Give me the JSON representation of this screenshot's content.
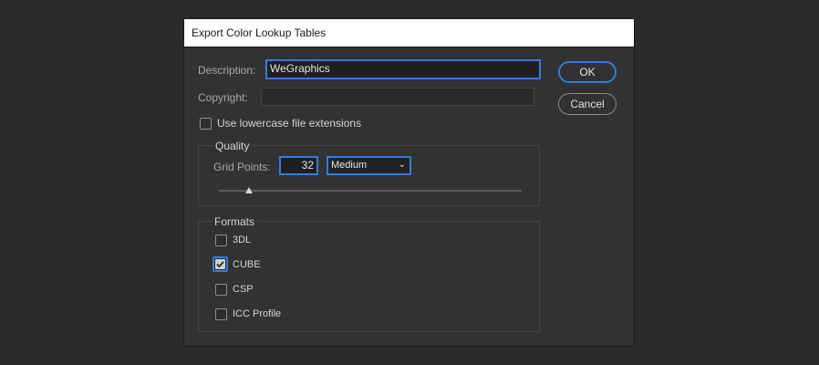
{
  "dialog": {
    "title": "Export Color Lookup Tables",
    "description_label": "Description:",
    "description_value": "WeGraphics",
    "copyright_label": "Copyright:",
    "copyright_value": "",
    "lowercase_label": "Use lowercase file extensions",
    "lowercase_checked": false,
    "ok_label": "OK",
    "cancel_label": "Cancel"
  },
  "quality": {
    "title": "Quality",
    "grid_points_label": "Grid Points:",
    "grid_points_value": "32",
    "preset_selected": "Medium",
    "slider_level_percent": 10
  },
  "formats": {
    "title": "Formats",
    "items": [
      {
        "label": "3DL",
        "checked": false
      },
      {
        "label": "CUBE",
        "checked": true
      },
      {
        "label": "CSP",
        "checked": false
      },
      {
        "label": "ICC Profile",
        "checked": false
      }
    ]
  },
  "colors": {
    "accent": "#2f7de1",
    "dialog_bg": "#323232",
    "page_bg": "#2b2b2b"
  }
}
